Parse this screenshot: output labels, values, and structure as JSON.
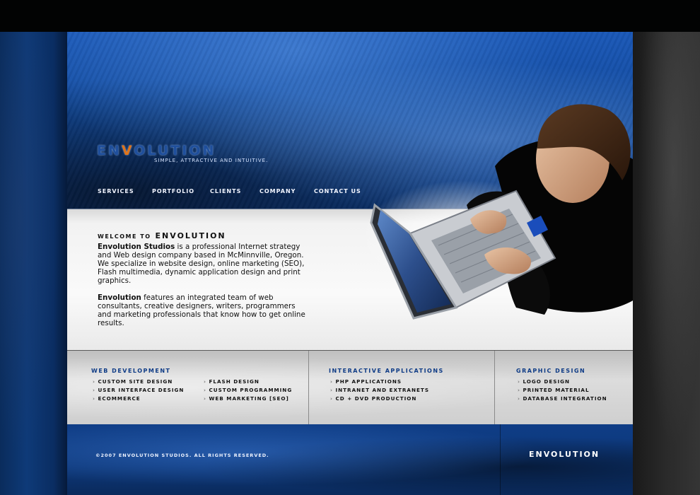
{
  "brand": {
    "logo_left": "EN",
    "logo_v": "V",
    "logo_right": "OLUTION",
    "tagline": "SIMPLE, ATTRACTIVE AND INTUITIVE.",
    "accent_color": "#e0741a",
    "primary_color": "#124a9c"
  },
  "nav": {
    "items": [
      {
        "label": "SERVICES"
      },
      {
        "label": "PORTFOLIO"
      },
      {
        "label": "CLIENTS"
      },
      {
        "label": "COMPANY"
      },
      {
        "label": "CONTACT US"
      }
    ]
  },
  "welcome": {
    "title_prefix": "WELCOME TO",
    "title_brand": "ENVOLUTION",
    "p1_bold": "Envolution Studios",
    "p1_rest": " is a professional Internet strategy and Web design company based in McMinnville, Oregon. We specialize in website design, online marketing (SEO), Flash multimedia, dynamic application design and print graphics.",
    "p2_bold": "Envolution",
    "p2_rest": " features an integrated team of web consultants, creative designers, writers, programmers and marketing professionals that know how to get online results."
  },
  "services": {
    "web_development": {
      "heading": "WEB DEVELOPMENT",
      "list_a": [
        "CUSTOM SITE DESIGN",
        "USER INTERFACE DESIGN",
        "ECOMMERCE"
      ],
      "list_b": [
        "FLASH DESIGN",
        "CUSTOM PROGRAMMING",
        "WEB MARKETING [SEO]"
      ]
    },
    "interactive_applications": {
      "heading": "INTERACTIVE APPLICATIONS",
      "list": [
        "PHP APPLICATIONS",
        "INTRANET AND EXTRANETS",
        "CD + DVD PRODUCTION"
      ]
    },
    "graphic_design": {
      "heading": "GRAPHIC DESIGN",
      "list": [
        "LOGO DESIGN",
        "PRINTED MATERIAL",
        "DATABASE INTEGRATION"
      ]
    }
  },
  "footer": {
    "copyright": "©2007 ENVOLUTION STUDIOS. ALL RIGHTS RESERVED.",
    "logo": "ENVOLUTION"
  }
}
